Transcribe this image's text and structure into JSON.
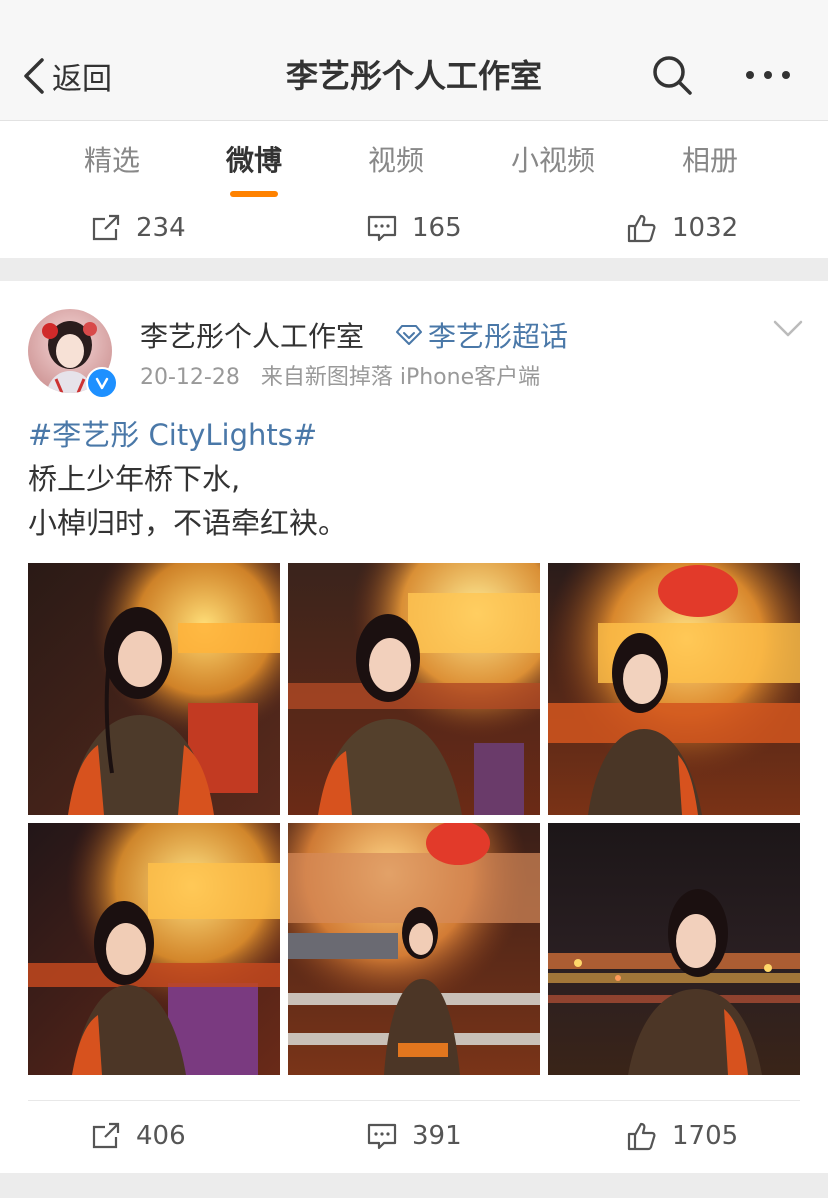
{
  "nav": {
    "back_label": "返回",
    "title": "李艺彤个人工作室"
  },
  "tabs": [
    {
      "label": "精选",
      "active": false
    },
    {
      "label": "微博",
      "active": true
    },
    {
      "label": "视频",
      "active": false
    },
    {
      "label": "小视频",
      "active": false
    },
    {
      "label": "相册",
      "active": false
    }
  ],
  "accent_color": "#ff8200",
  "link_color": "#4a78a8",
  "prev_post": {
    "reposts": "234",
    "comments": "165",
    "likes": "1032"
  },
  "post": {
    "author": "李艺彤个人工作室",
    "verified": true,
    "topic_label": "李艺彤超话",
    "date": "20-12-28",
    "source": "来自新图掉落 iPhone客户端",
    "hashtag": "#李艺彤 CityLights#",
    "lines": [
      "桥上少年桥下水,",
      "小棹归时，不语牵红袂。"
    ],
    "photo_count": 6,
    "reposts": "406",
    "comments": "391",
    "likes": "1705"
  }
}
